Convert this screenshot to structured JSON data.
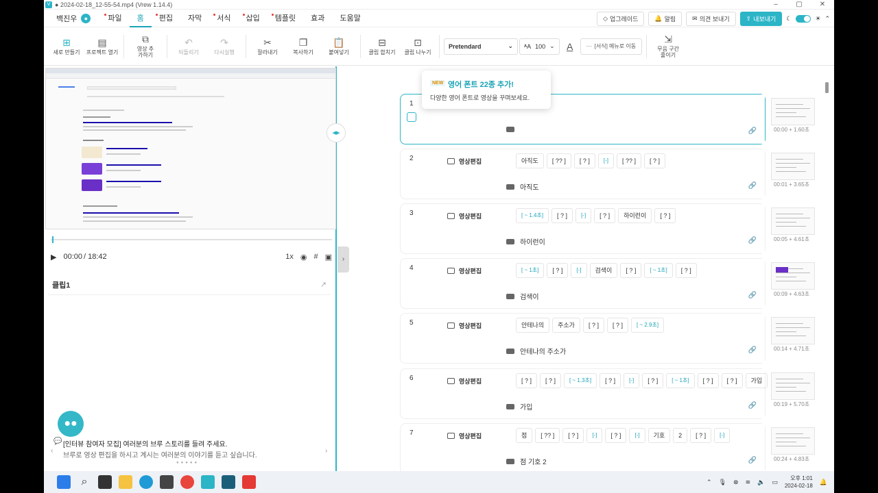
{
  "window": {
    "title": "● 2024-02-18_12-55-54.mp4 (Vrew 1.14.4)"
  },
  "menu": {
    "user": "백진우",
    "items": [
      "파일",
      "홈",
      "편집",
      "자막",
      "서식",
      "삽입",
      "템플릿",
      "효과",
      "도움말"
    ],
    "active": "홈"
  },
  "topright": {
    "upgrade": "업그레이드",
    "alarm": "알림",
    "feedback": "의견 보내기",
    "export": "내보내기"
  },
  "toolbar": {
    "new": "새로 만들기",
    "open": "프로젝트 열기",
    "add_video": "영상 추가하기",
    "undo": "되돌리기",
    "redo": "다시실행",
    "cut": "잘라내기",
    "copy": "복사하기",
    "paste": "붙여넣기",
    "merge": "클립 합치기",
    "split": "클립 나누기",
    "font": "Pretendard",
    "size": "100",
    "format_more": "[서식] 메뉴로 이동",
    "silence": "무음 구간 줄이기"
  },
  "tooltip": {
    "badge": "NEW",
    "title": "영어 폰트 22종 추가!",
    "desc": "다양한 영어 폰트로 영상을 꾸며보세요."
  },
  "player": {
    "time": "00:00",
    "duration": "/ 18:42",
    "speed": "1x"
  },
  "clip_panel": {
    "title": "클립1"
  },
  "notice": {
    "title": "[인터뷰 참여자 모집] 여러분의 브루 스토리를 들려 주세요.",
    "sub": "브루로 영상 편집을 하시고 계시는 여러분의 이야기를 듣고 싶습니다."
  },
  "clips": [
    {
      "num": "1",
      "speaker": "",
      "words": [],
      "subtitle": "",
      "time": "00:00 + 1.60초"
    },
    {
      "num": "2",
      "speaker": "영상편집",
      "words": [
        "아직도",
        "[ ?? ]",
        "[ ? ]",
        "[-]",
        "[ ?? ]",
        "[ ? ]"
      ],
      "subtitle": "아직도",
      "time": "00:01 + 3.65초"
    },
    {
      "num": "3",
      "speaker": "영상편집",
      "words": [
        "[ ~ 1.4초]",
        "[ ? ]",
        "[-]",
        "[ ? ]",
        "하이런이",
        "[ ? ]"
      ],
      "subtitle": "하이런이",
      "time": "00:05 + 4.61초"
    },
    {
      "num": "4",
      "speaker": "영상편집",
      "words": [
        "[ ~ 1초]",
        "[ ? ]",
        "[-]",
        "검색이",
        "[ ? ]",
        "[ ~ 1초]",
        "[ ? ]"
      ],
      "subtitle": "검색이",
      "time": "00:09 + 4.63초"
    },
    {
      "num": "5",
      "speaker": "영상편집",
      "words": [
        "안테나의",
        "주소가",
        "[ ? ]",
        "[ ? ]",
        "[ ~ 2.9초]"
      ],
      "subtitle": "안테나의 주소가",
      "time": "00:14 + 4.71초"
    },
    {
      "num": "6",
      "speaker": "영상편집",
      "words": [
        "[ ? ]",
        "[ ? ]",
        "[ ~ 1.3초]",
        "[ ? ]",
        "[-]",
        "[ ? ]",
        "[ ~ 1초]",
        "[ ? ]",
        "[ ? ]",
        "가입"
      ],
      "subtitle": "가입",
      "time": "00:19 + 5.70초"
    },
    {
      "num": "7",
      "speaker": "영상편집",
      "words": [
        "점",
        "[ ?? ]",
        "[ ? ]",
        "[-]",
        "[ ? ]",
        "[-]",
        "기호",
        "2",
        "[ ? ]",
        "[-]"
      ],
      "subtitle": "점 기호 2",
      "time": "00:24 + 4.83초"
    }
  ],
  "taskbar": {
    "time": "오후 1:01",
    "date": "2024-02-18"
  }
}
